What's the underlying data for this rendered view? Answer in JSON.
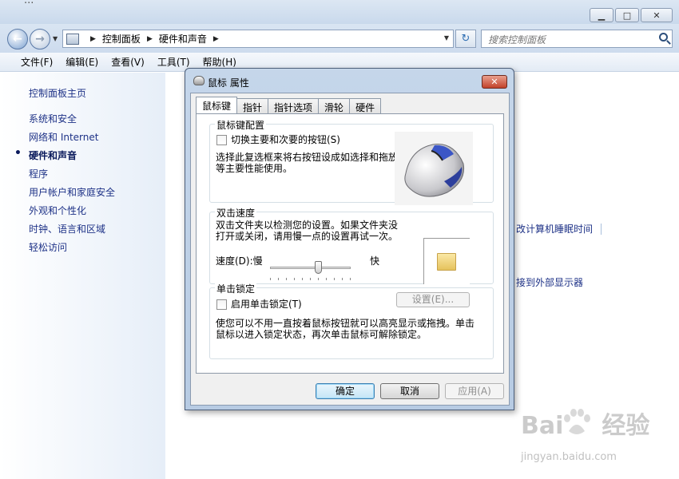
{
  "window": {
    "title_fragment": "...",
    "minimize": "▭",
    "maximize": "□",
    "close": "✕"
  },
  "address": {
    "crumbs": [
      "控制面板",
      "硬件和声音"
    ],
    "search_placeholder": "搜索控制面板"
  },
  "menu": [
    "文件(F)",
    "编辑(E)",
    "查看(V)",
    "工具(T)",
    "帮助(H)"
  ],
  "sidebar": {
    "home": "控制面板主页",
    "items": [
      {
        "label": "系统和安全",
        "active": false
      },
      {
        "label": "网络和 Internet",
        "active": false
      },
      {
        "label": "硬件和声音",
        "active": true
      },
      {
        "label": "程序",
        "active": false
      },
      {
        "label": "用户帐户和家庭安全",
        "active": false
      },
      {
        "label": "外观和个性化",
        "active": false
      },
      {
        "label": "时钟、语言和区域",
        "active": false
      },
      {
        "label": "轻松访问",
        "active": false
      }
    ]
  },
  "background_links": {
    "sleep": "改计算机睡眠时间",
    "display": "接到外部显示器"
  },
  "dialog": {
    "title": "鼠标 属性",
    "tabs": [
      "鼠标键",
      "指针",
      "指针选项",
      "滑轮",
      "硬件"
    ],
    "button_config": {
      "label": "鼠标键配置",
      "checkbox_label": "切换主要和次要的按钮(S)",
      "checked": false,
      "description_line1": "选择此复选框来将右按钮设成如选择和拖放",
      "description_line2": "等主要性能使用。"
    },
    "double_click": {
      "label": "双击速度",
      "description_line1": "双击文件夹以检测您的设置。如果文件夹没",
      "description_line2": "打开或关闭，请用慢一点的设置再试一次。",
      "speed_label": "速度(D):慢",
      "fast_label": "快",
      "speed_fraction": 0.6
    },
    "click_lock": {
      "label": "单击锁定",
      "checkbox_label": "启用单击锁定(T)",
      "checked": false,
      "settings_button": "设置(E)...",
      "description_line1": "使您可以不用一直按着鼠标按钮就可以高亮显示或拖拽。单击",
      "description_line2": "鼠标以进入锁定状态，再次单击鼠标可解除锁定。"
    },
    "buttons": {
      "ok": "确定",
      "cancel": "取消",
      "apply": "应用(A)"
    }
  },
  "watermark": {
    "brand_left": "Bai",
    "brand_right": "经验",
    "url": "jingyan.baidu.com"
  }
}
